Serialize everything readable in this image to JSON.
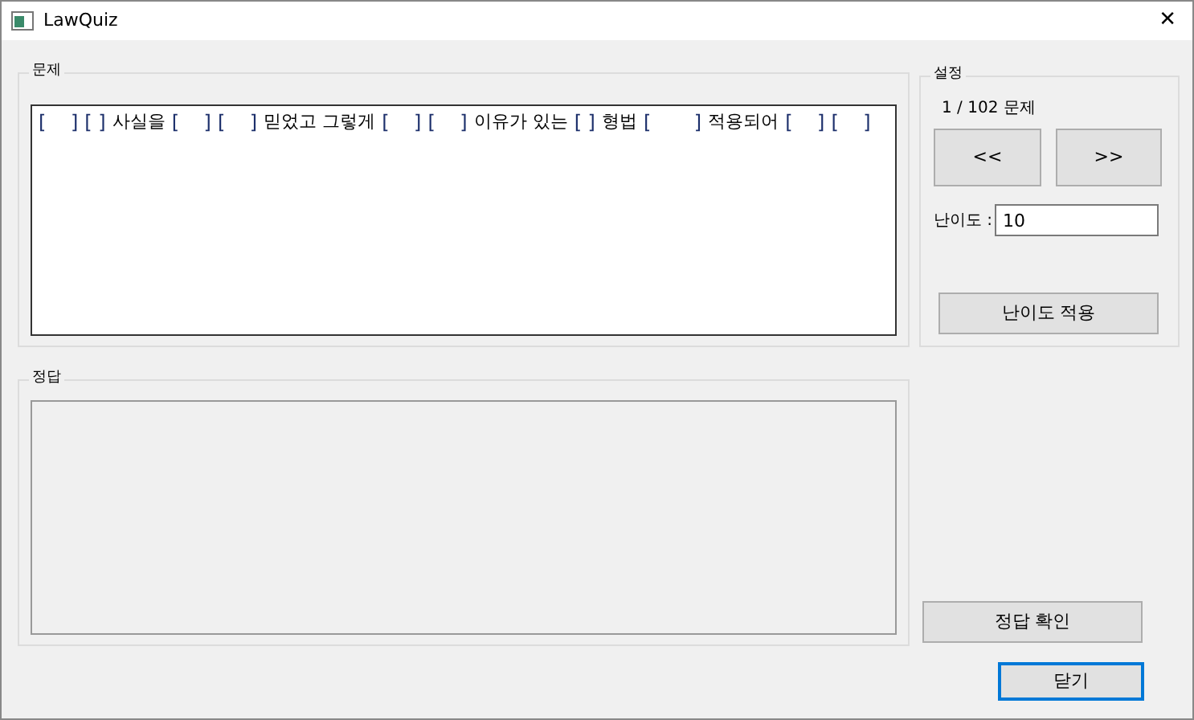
{
  "window": {
    "title": "LawQuiz",
    "close": "✕"
  },
  "question": {
    "label": "문제",
    "segments": [
      {
        "kind": "blank",
        "text": "[    ]"
      },
      {
        "kind": "blank",
        "text": "[ ]"
      },
      {
        "kind": "text",
        "text": "사실을"
      },
      {
        "kind": "blank",
        "text": "[    ]"
      },
      {
        "kind": "blank",
        "text": "[    ]"
      },
      {
        "kind": "text",
        "text": "믿었고 그렇게"
      },
      {
        "kind": "blank",
        "text": "[    ]"
      },
      {
        "kind": "blank",
        "text": "[    ]"
      },
      {
        "kind": "text",
        "text": "이유가 있는"
      },
      {
        "kind": "blank",
        "text": "[ ]"
      },
      {
        "kind": "text",
        "text": "형법"
      },
      {
        "kind": "blank",
        "text": "[       ]"
      },
      {
        "kind": "text",
        "text": "적용되어"
      },
      {
        "kind": "blank",
        "text": "[    ]"
      },
      {
        "kind": "blank",
        "text": "[    ]"
      }
    ]
  },
  "answer": {
    "label": "정답"
  },
  "settings": {
    "label": "설정",
    "counter": "1 / 102 문제",
    "prev": "<<",
    "next": ">>",
    "difficulty_label": "난이도 :",
    "difficulty": "10",
    "apply": "난이도 적용"
  },
  "check_button": "정답 확인",
  "close_button": "닫기"
}
